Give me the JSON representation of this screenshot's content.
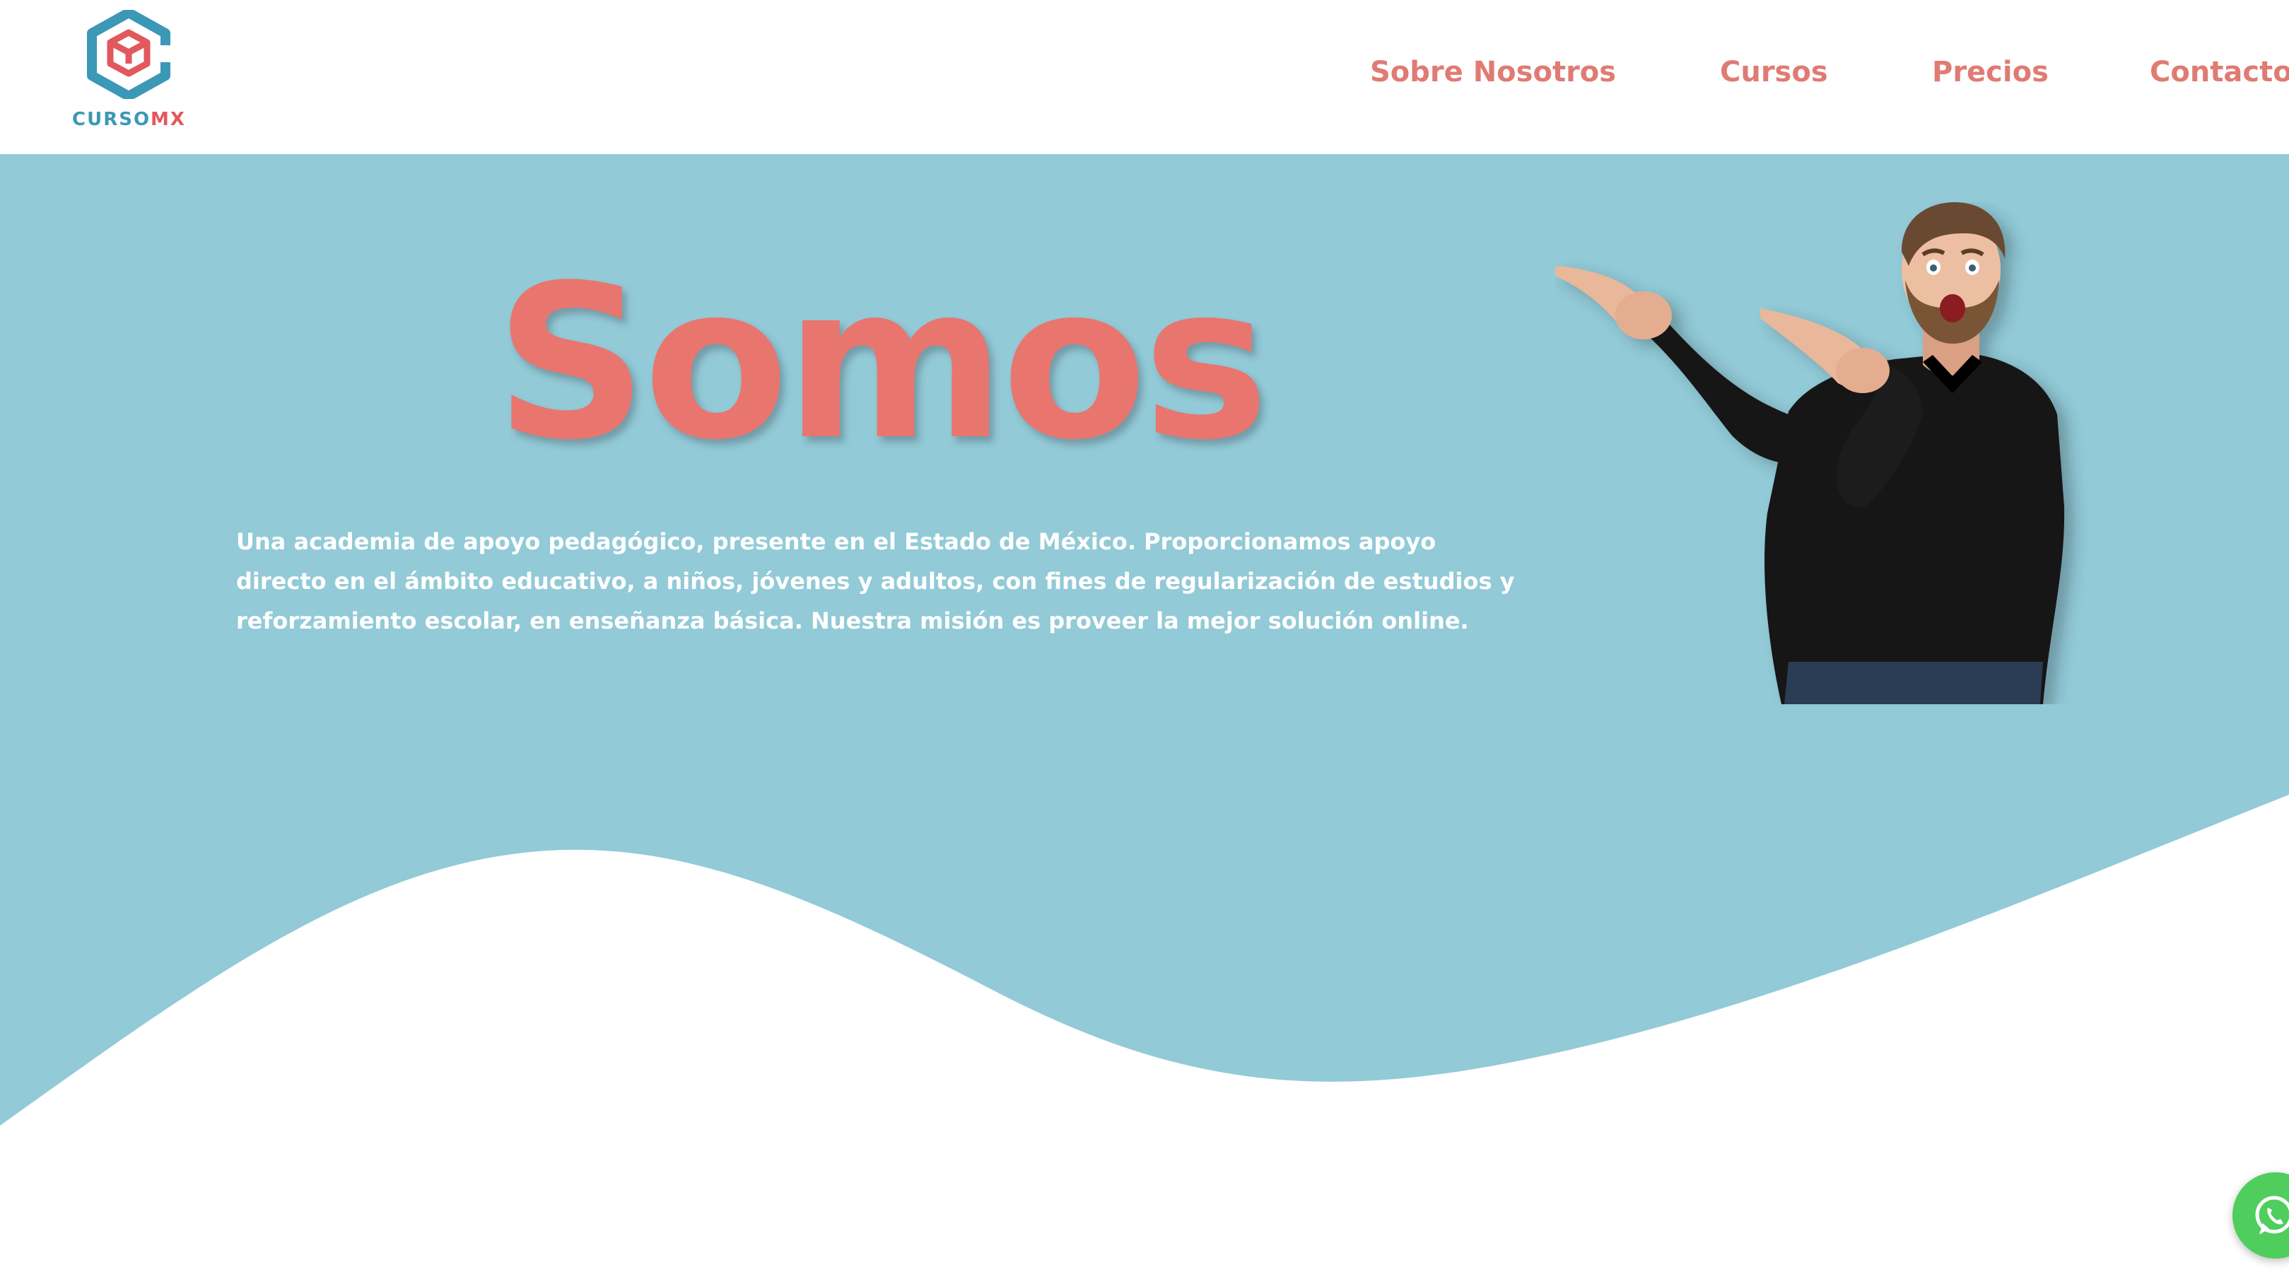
{
  "brand": {
    "name_part1": "CURSO",
    "name_part2": "MX",
    "logo_icon": "hexagon-cube-logo-icon"
  },
  "nav": {
    "items": [
      {
        "label": "Sobre Nosotros"
      },
      {
        "label": "Cursos"
      },
      {
        "label": "Precios"
      },
      {
        "label": "Contacto"
      }
    ]
  },
  "hero": {
    "title": "Somos",
    "description": "Una academia de apoyo pedagógico, presente en el Estado de México. Proporcionamos apoyo directo en el ámbito educativo, a niños, jóvenes y adultos, con fines de regularización de estudios y reforzamiento escolar, en enseñanza básica. Nuestra misión es proveer la mejor solución online.",
    "image": "man-pointing-illustration"
  },
  "floating": {
    "whatsapp_icon": "whatsapp-icon"
  },
  "colors": {
    "accent": "#e07b74",
    "hero_background": "#92cad7",
    "logo_blue": "#3b98b6",
    "logo_red": "#e2585c",
    "whatsapp_green": "#4fce5d"
  }
}
